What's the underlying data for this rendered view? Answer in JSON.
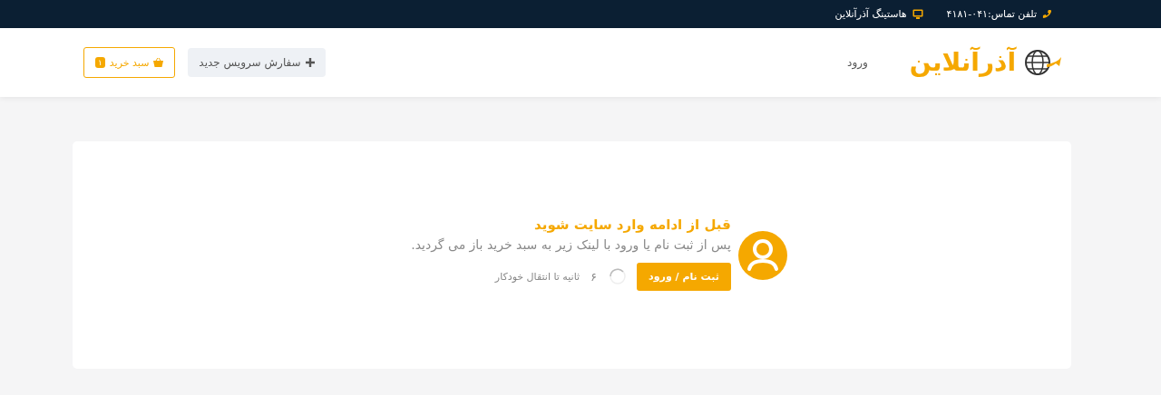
{
  "top_bar": {
    "items": [
      {
        "kind": "phone",
        "text": "تلفن تماس:۰۴۱-۴۱۸۱"
      },
      {
        "kind": "monitor",
        "text": "هاستینگ آذرآنلاین"
      }
    ]
  },
  "header": {
    "logo": "آذرآنلاین",
    "nav": [
      {
        "label": "ورود"
      }
    ],
    "new_order_button": "سفارش سرویس جدید",
    "cart_button": {
      "label": "سبد خرید",
      "count": "۱"
    }
  },
  "notice": {
    "title": "قبل از ادامه وارد سایت شوید",
    "message": "پس از ثبت نام یا ورود با لینک زیر به سبد خرید باز می گردید.",
    "button": "ثبت نام / ورود",
    "countdown": "۶",
    "countdown_text": "ثانیه تا انتقال خودکار"
  }
}
